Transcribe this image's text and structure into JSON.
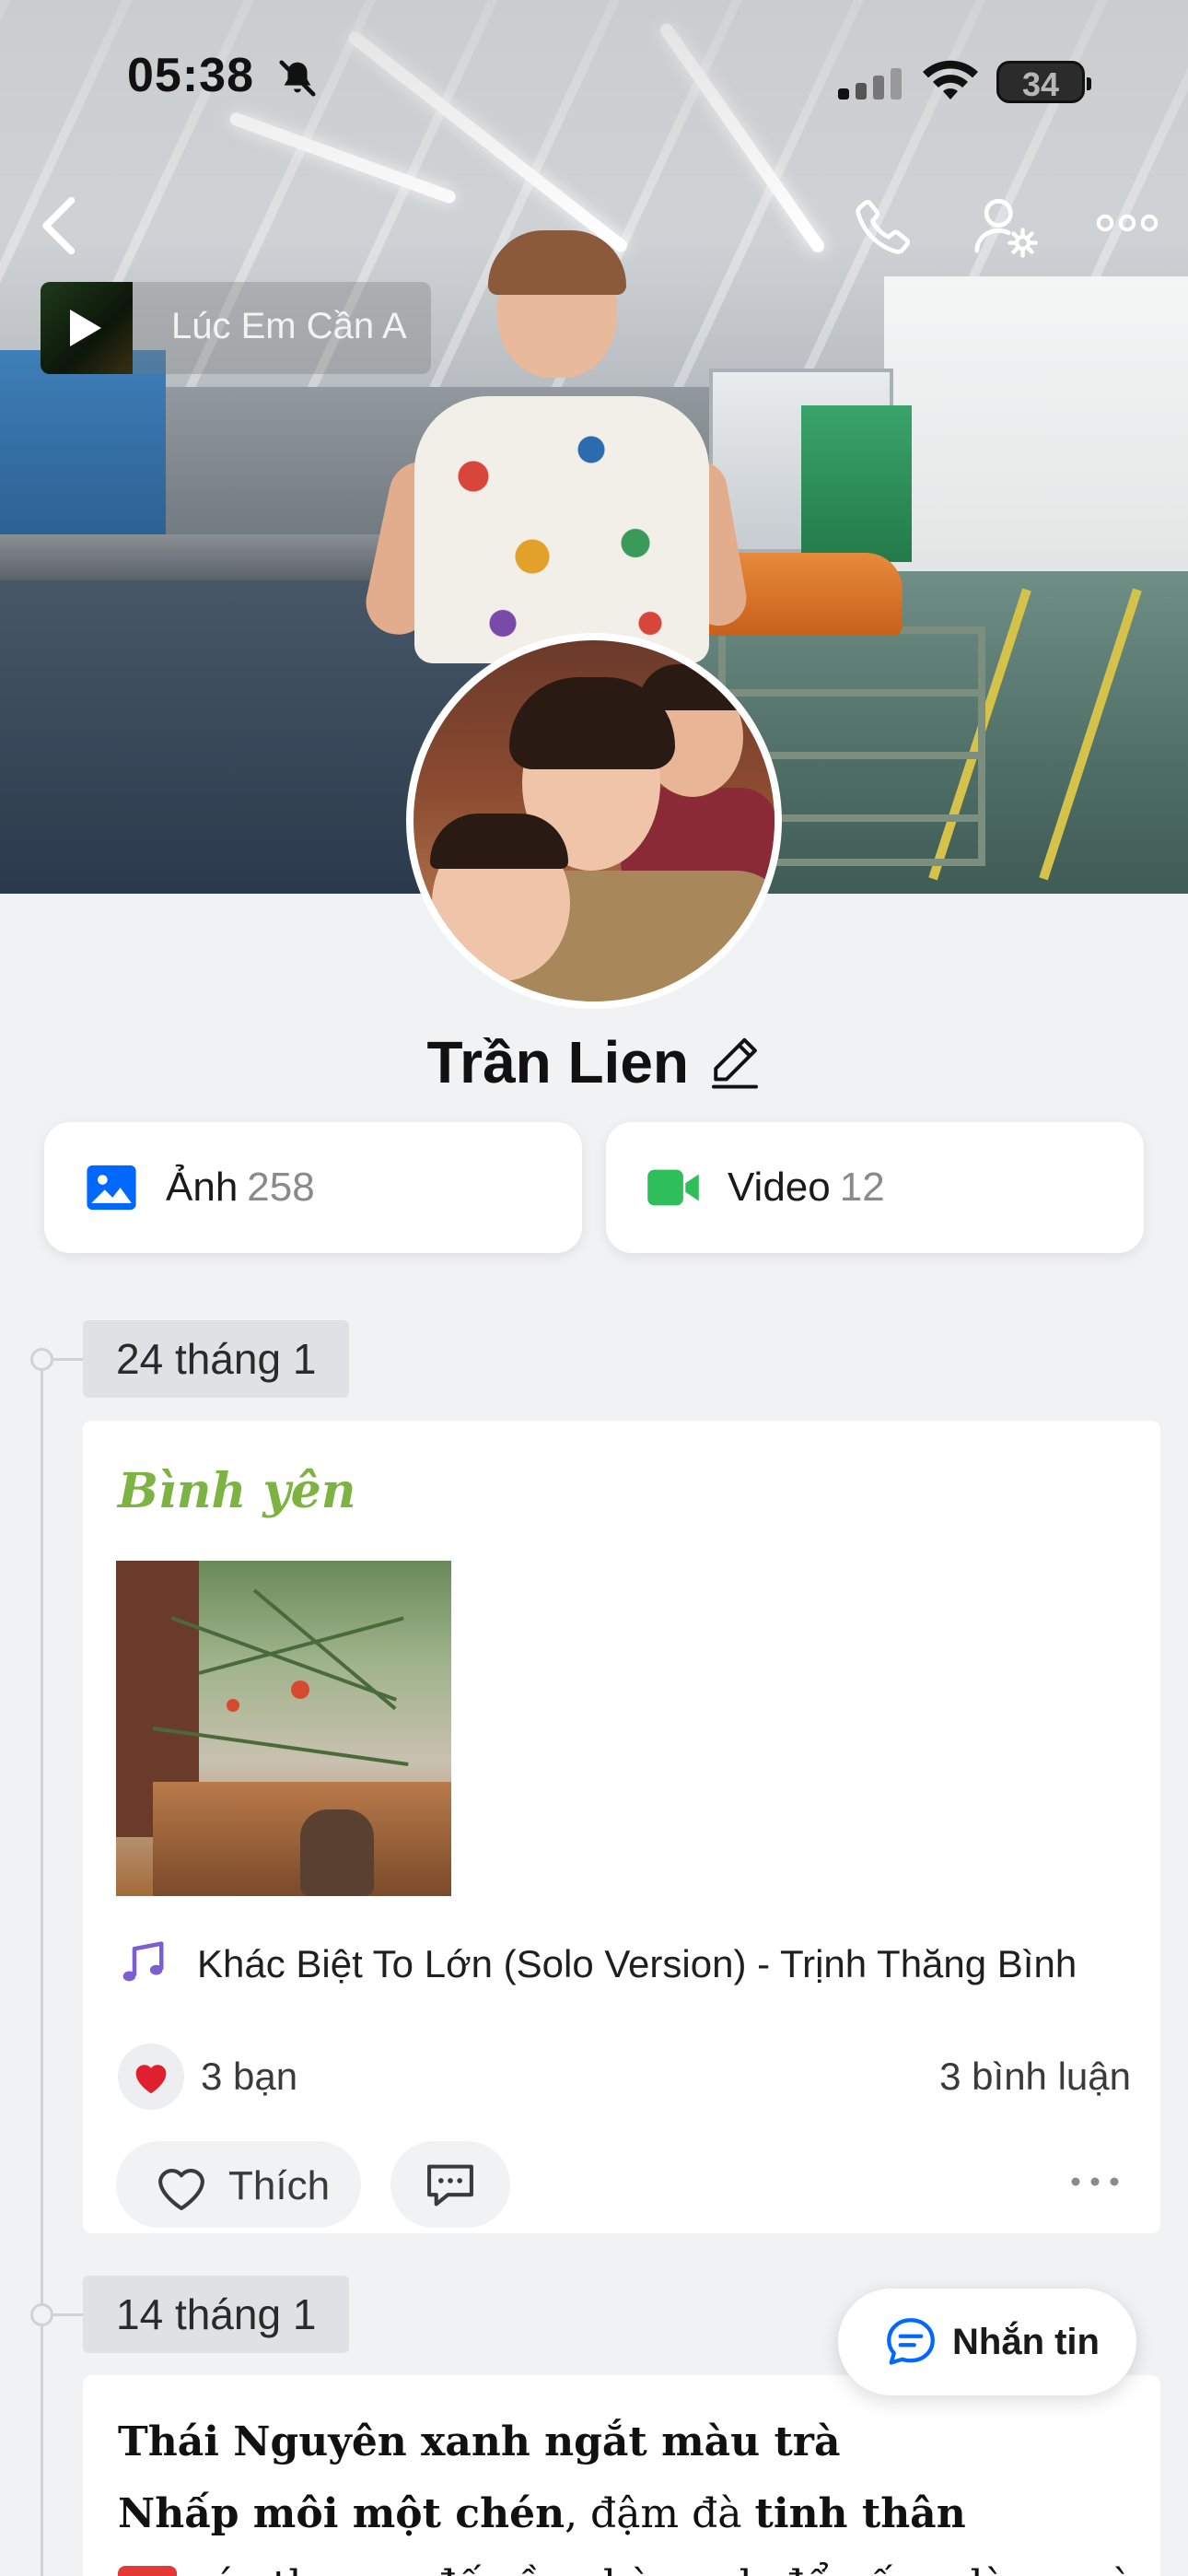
{
  "status_bar": {
    "time": "05:38",
    "battery": "34"
  },
  "music": {
    "title": "Lúc Em Cần A"
  },
  "profile": {
    "name": "Trần Lien"
  },
  "media": {
    "photos_label": "Ảnh",
    "photos_count": "258",
    "videos_label": "Video",
    "videos_count": "12"
  },
  "timeline": [
    {
      "date": "24 tháng 1",
      "title": "Bình yên",
      "song": "Khác Biệt To Lớn (Solo Version) - Trịnh Thăng Bình",
      "reactions": "3 bạn",
      "comments": "3 bình luận",
      "like_label": "Thích"
    },
    {
      "date": "14 tháng 1",
      "line1": "Thái Nguyên xanh ngắt màu trà",
      "line2_a": "Nhấp môi một chén",
      "line2_b": ", đậm đà ",
      "line2_c": "tinh thân",
      "line3_badge": "SOS",
      "line3": " các thượng đế cần chè xanh để uống, làm quà"
    }
  ],
  "floating": {
    "message_label": "Nhắn tin"
  },
  "colors": {
    "accent_blue": "#0068ff",
    "video_green": "#2fbf5a",
    "post_title_green": "#7cb342",
    "heart_red": "#e0202e"
  }
}
